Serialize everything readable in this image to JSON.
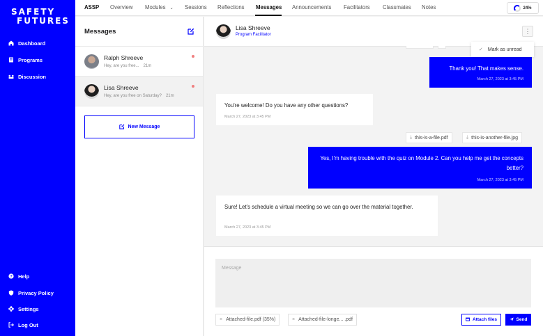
{
  "sidebar": {
    "logo_line1": "SAFETY",
    "logo_line2": "FUTURES",
    "nav": [
      {
        "label": "Dashboard",
        "icon": "home-icon"
      },
      {
        "label": "Programs",
        "icon": "book-icon"
      },
      {
        "label": "Discussion",
        "icon": "chat-icon"
      }
    ],
    "bottom": [
      {
        "label": "Help",
        "icon": "help-icon"
      },
      {
        "label": "Privacy Policy",
        "icon": "shield-icon"
      },
      {
        "label": "Settings",
        "icon": "gear-icon"
      },
      {
        "label": "Log Out",
        "icon": "logout-icon"
      }
    ]
  },
  "topnav": {
    "brand": "ASSP",
    "items": [
      "Overview",
      "Modules",
      "Sessions",
      "Reflections",
      "Messages",
      "Announcements",
      "Facilitators",
      "Classmates",
      "Notes"
    ],
    "active": "Messages",
    "progress": "24%"
  },
  "conversations": {
    "title": "Messages",
    "items": [
      {
        "name": "Ralph Shreeve",
        "preview": "Hey, are you free...",
        "time": "21m",
        "unread": true
      },
      {
        "name": "Lisa Shreeve",
        "preview": "Hey, are you free on Saturday?",
        "time": "21m",
        "unread": true
      }
    ],
    "new_message_label": "New Message"
  },
  "chat": {
    "name": "Lisa Shreeve",
    "role": "Program Facilitator",
    "menu_item": "Mark as unread",
    "messages": [
      {
        "dir": "out",
        "text": "Thank you! That makes sense.",
        "time": "March 27, 2023 at 3:45 PM"
      },
      {
        "dir": "in",
        "text": "You're welcome! Do you have any other questions?",
        "time": "March 27, 2023 at 3:45 PM"
      },
      {
        "dir": "out",
        "text": "Yes, I'm having trouble with the quiz on Module 2. Can you help me get the concepts better?",
        "time": "March 27, 2023 at 3:45 PM"
      },
      {
        "dir": "in",
        "text": "Sure! Let's schedule a virtual meeting so we can go over the material together.",
        "time": "March 27, 2023 at 3:45 PM"
      }
    ],
    "files": [
      "this-is-a-file.pdf",
      "this-is-another-file.jpg"
    ]
  },
  "composer": {
    "placeholder": "Message",
    "attachments": [
      "Attached-file.pdf (35%)",
      "Attached-file-longe... .pdf"
    ],
    "attach_label": "Attach files",
    "send_label": "Send"
  },
  "colors": {
    "brand": "#0000ff"
  }
}
